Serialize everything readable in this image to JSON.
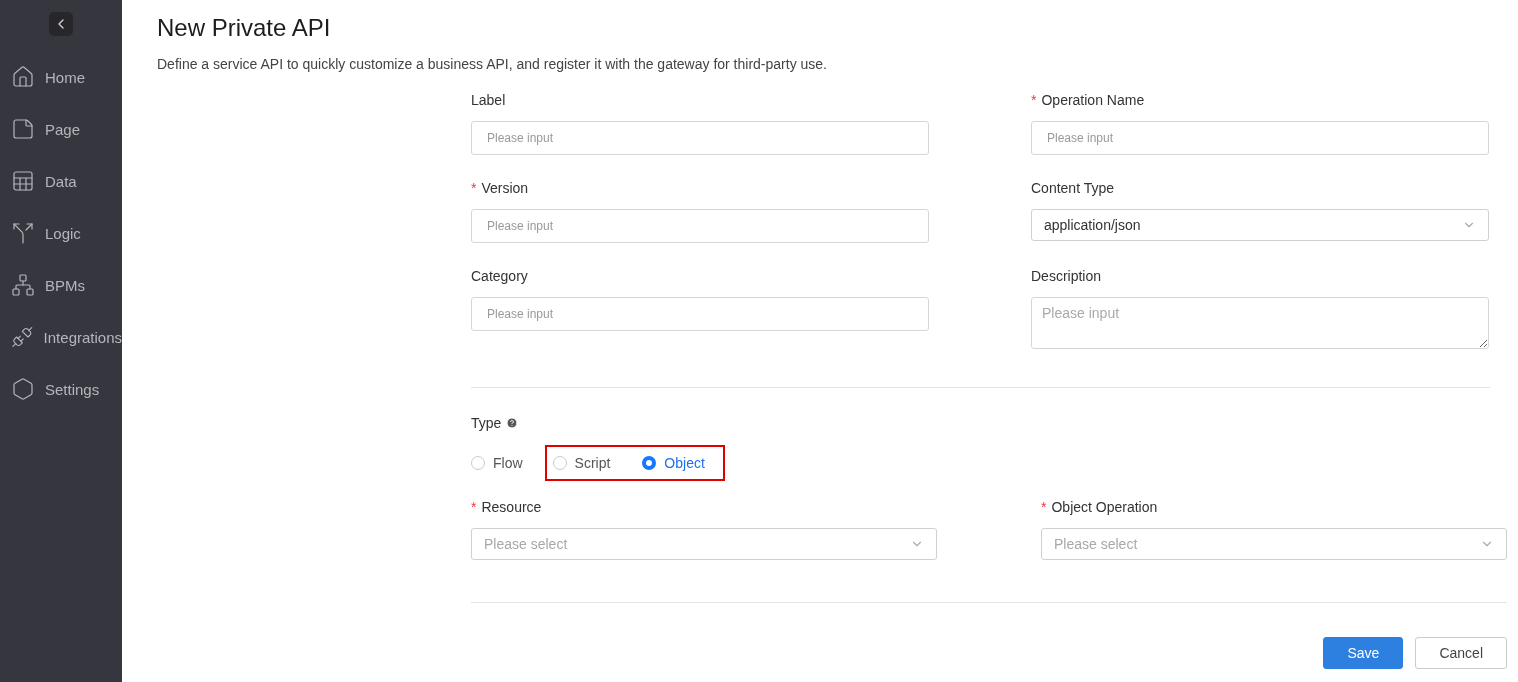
{
  "sidebar": {
    "items": [
      {
        "kind": "home",
        "label": "Home"
      },
      {
        "kind": "page",
        "label": "Page"
      },
      {
        "kind": "data",
        "label": "Data"
      },
      {
        "kind": "logic",
        "label": "Logic"
      },
      {
        "kind": "bpm",
        "label": "BPMs"
      },
      {
        "kind": "integrations",
        "label": "Integrations"
      },
      {
        "kind": "settings",
        "label": "Settings"
      }
    ]
  },
  "header": {
    "title": "New Private API",
    "description": "Define a service API to quickly customize a business API, and register it with the gateway for third-party use."
  },
  "fields": [
    {
      "kind": "input",
      "label": "Label",
      "placeholder": "Please input"
    },
    {
      "kind": "input",
      "label": "Operation Name",
      "required_mark": "*",
      "placeholder": "Please input"
    },
    {
      "kind": "input",
      "label": "Version",
      "required_mark": "*",
      "placeholder": "Please input"
    },
    {
      "kind": "select",
      "label": "Content Type",
      "value": "application/json"
    },
    {
      "kind": "input",
      "label": "Category",
      "placeholder": "Please input"
    },
    {
      "kind": "textarea",
      "label": "Description",
      "placeholder": "Please input"
    }
  ],
  "type": {
    "label": "Type",
    "options": [
      {
        "label": "Flow",
        "selected": false,
        "highlighted": false
      },
      {
        "label": "Script",
        "selected": false,
        "highlighted": true
      },
      {
        "label": "Object",
        "selected": true,
        "highlighted": true
      }
    ]
  },
  "object_fields": [
    {
      "kind": "select",
      "label": "Resource",
      "required_mark": "*",
      "placeholder": "Please select"
    },
    {
      "kind": "select",
      "label": "Object Operation",
      "required_mark": "*",
      "placeholder": "Please select"
    }
  ],
  "buttons": [
    {
      "kind": "primary",
      "label": "Save"
    },
    {
      "kind": "default",
      "label": "Cancel"
    }
  ]
}
